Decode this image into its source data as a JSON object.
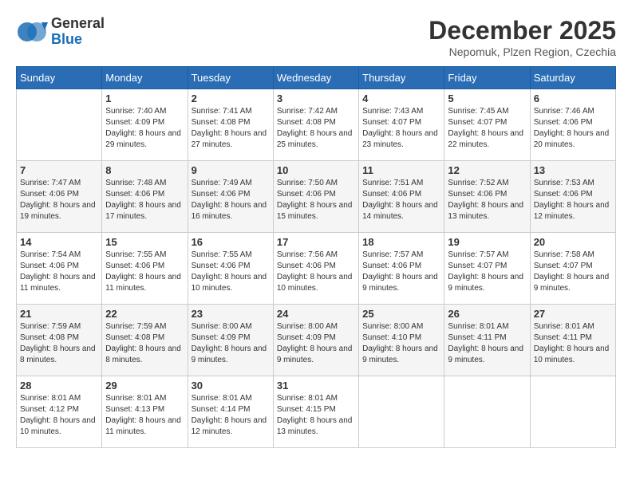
{
  "header": {
    "logo_general": "General",
    "logo_blue": "Blue",
    "month_year": "December 2025",
    "location": "Nepomuk, Plzen Region, Czechia"
  },
  "weekdays": [
    "Sunday",
    "Monday",
    "Tuesday",
    "Wednesday",
    "Thursday",
    "Friday",
    "Saturday"
  ],
  "weeks": [
    [
      {
        "day": "",
        "sunrise": "",
        "sunset": "",
        "daylight": ""
      },
      {
        "day": "1",
        "sunrise": "7:40 AM",
        "sunset": "4:09 PM",
        "daylight": "8 hours and 29 minutes."
      },
      {
        "day": "2",
        "sunrise": "7:41 AM",
        "sunset": "4:08 PM",
        "daylight": "8 hours and 27 minutes."
      },
      {
        "day": "3",
        "sunrise": "7:42 AM",
        "sunset": "4:08 PM",
        "daylight": "8 hours and 25 minutes."
      },
      {
        "day": "4",
        "sunrise": "7:43 AM",
        "sunset": "4:07 PM",
        "daylight": "8 hours and 23 minutes."
      },
      {
        "day": "5",
        "sunrise": "7:45 AM",
        "sunset": "4:07 PM",
        "daylight": "8 hours and 22 minutes."
      },
      {
        "day": "6",
        "sunrise": "7:46 AM",
        "sunset": "4:06 PM",
        "daylight": "8 hours and 20 minutes."
      }
    ],
    [
      {
        "day": "7",
        "sunrise": "7:47 AM",
        "sunset": "4:06 PM",
        "daylight": "8 hours and 19 minutes."
      },
      {
        "day": "8",
        "sunrise": "7:48 AM",
        "sunset": "4:06 PM",
        "daylight": "8 hours and 17 minutes."
      },
      {
        "day": "9",
        "sunrise": "7:49 AM",
        "sunset": "4:06 PM",
        "daylight": "8 hours and 16 minutes."
      },
      {
        "day": "10",
        "sunrise": "7:50 AM",
        "sunset": "4:06 PM",
        "daylight": "8 hours and 15 minutes."
      },
      {
        "day": "11",
        "sunrise": "7:51 AM",
        "sunset": "4:06 PM",
        "daylight": "8 hours and 14 minutes."
      },
      {
        "day": "12",
        "sunrise": "7:52 AM",
        "sunset": "4:06 PM",
        "daylight": "8 hours and 13 minutes."
      },
      {
        "day": "13",
        "sunrise": "7:53 AM",
        "sunset": "4:06 PM",
        "daylight": "8 hours and 12 minutes."
      }
    ],
    [
      {
        "day": "14",
        "sunrise": "7:54 AM",
        "sunset": "4:06 PM",
        "daylight": "8 hours and 11 minutes."
      },
      {
        "day": "15",
        "sunrise": "7:55 AM",
        "sunset": "4:06 PM",
        "daylight": "8 hours and 11 minutes."
      },
      {
        "day": "16",
        "sunrise": "7:55 AM",
        "sunset": "4:06 PM",
        "daylight": "8 hours and 10 minutes."
      },
      {
        "day": "17",
        "sunrise": "7:56 AM",
        "sunset": "4:06 PM",
        "daylight": "8 hours and 10 minutes."
      },
      {
        "day": "18",
        "sunrise": "7:57 AM",
        "sunset": "4:06 PM",
        "daylight": "8 hours and 9 minutes."
      },
      {
        "day": "19",
        "sunrise": "7:57 AM",
        "sunset": "4:07 PM",
        "daylight": "8 hours and 9 minutes."
      },
      {
        "day": "20",
        "sunrise": "7:58 AM",
        "sunset": "4:07 PM",
        "daylight": "8 hours and 9 minutes."
      }
    ],
    [
      {
        "day": "21",
        "sunrise": "7:59 AM",
        "sunset": "4:08 PM",
        "daylight": "8 hours and 8 minutes."
      },
      {
        "day": "22",
        "sunrise": "7:59 AM",
        "sunset": "4:08 PM",
        "daylight": "8 hours and 8 minutes."
      },
      {
        "day": "23",
        "sunrise": "8:00 AM",
        "sunset": "4:09 PM",
        "daylight": "8 hours and 9 minutes."
      },
      {
        "day": "24",
        "sunrise": "8:00 AM",
        "sunset": "4:09 PM",
        "daylight": "8 hours and 9 minutes."
      },
      {
        "day": "25",
        "sunrise": "8:00 AM",
        "sunset": "4:10 PM",
        "daylight": "8 hours and 9 minutes."
      },
      {
        "day": "26",
        "sunrise": "8:01 AM",
        "sunset": "4:11 PM",
        "daylight": "8 hours and 9 minutes."
      },
      {
        "day": "27",
        "sunrise": "8:01 AM",
        "sunset": "4:11 PM",
        "daylight": "8 hours and 10 minutes."
      }
    ],
    [
      {
        "day": "28",
        "sunrise": "8:01 AM",
        "sunset": "4:12 PM",
        "daylight": "8 hours and 10 minutes."
      },
      {
        "day": "29",
        "sunrise": "8:01 AM",
        "sunset": "4:13 PM",
        "daylight": "8 hours and 11 minutes."
      },
      {
        "day": "30",
        "sunrise": "8:01 AM",
        "sunset": "4:14 PM",
        "daylight": "8 hours and 12 minutes."
      },
      {
        "day": "31",
        "sunrise": "8:01 AM",
        "sunset": "4:15 PM",
        "daylight": "8 hours and 13 minutes."
      },
      {
        "day": "",
        "sunrise": "",
        "sunset": "",
        "daylight": ""
      },
      {
        "day": "",
        "sunrise": "",
        "sunset": "",
        "daylight": ""
      },
      {
        "day": "",
        "sunrise": "",
        "sunset": "",
        "daylight": ""
      }
    ]
  ]
}
